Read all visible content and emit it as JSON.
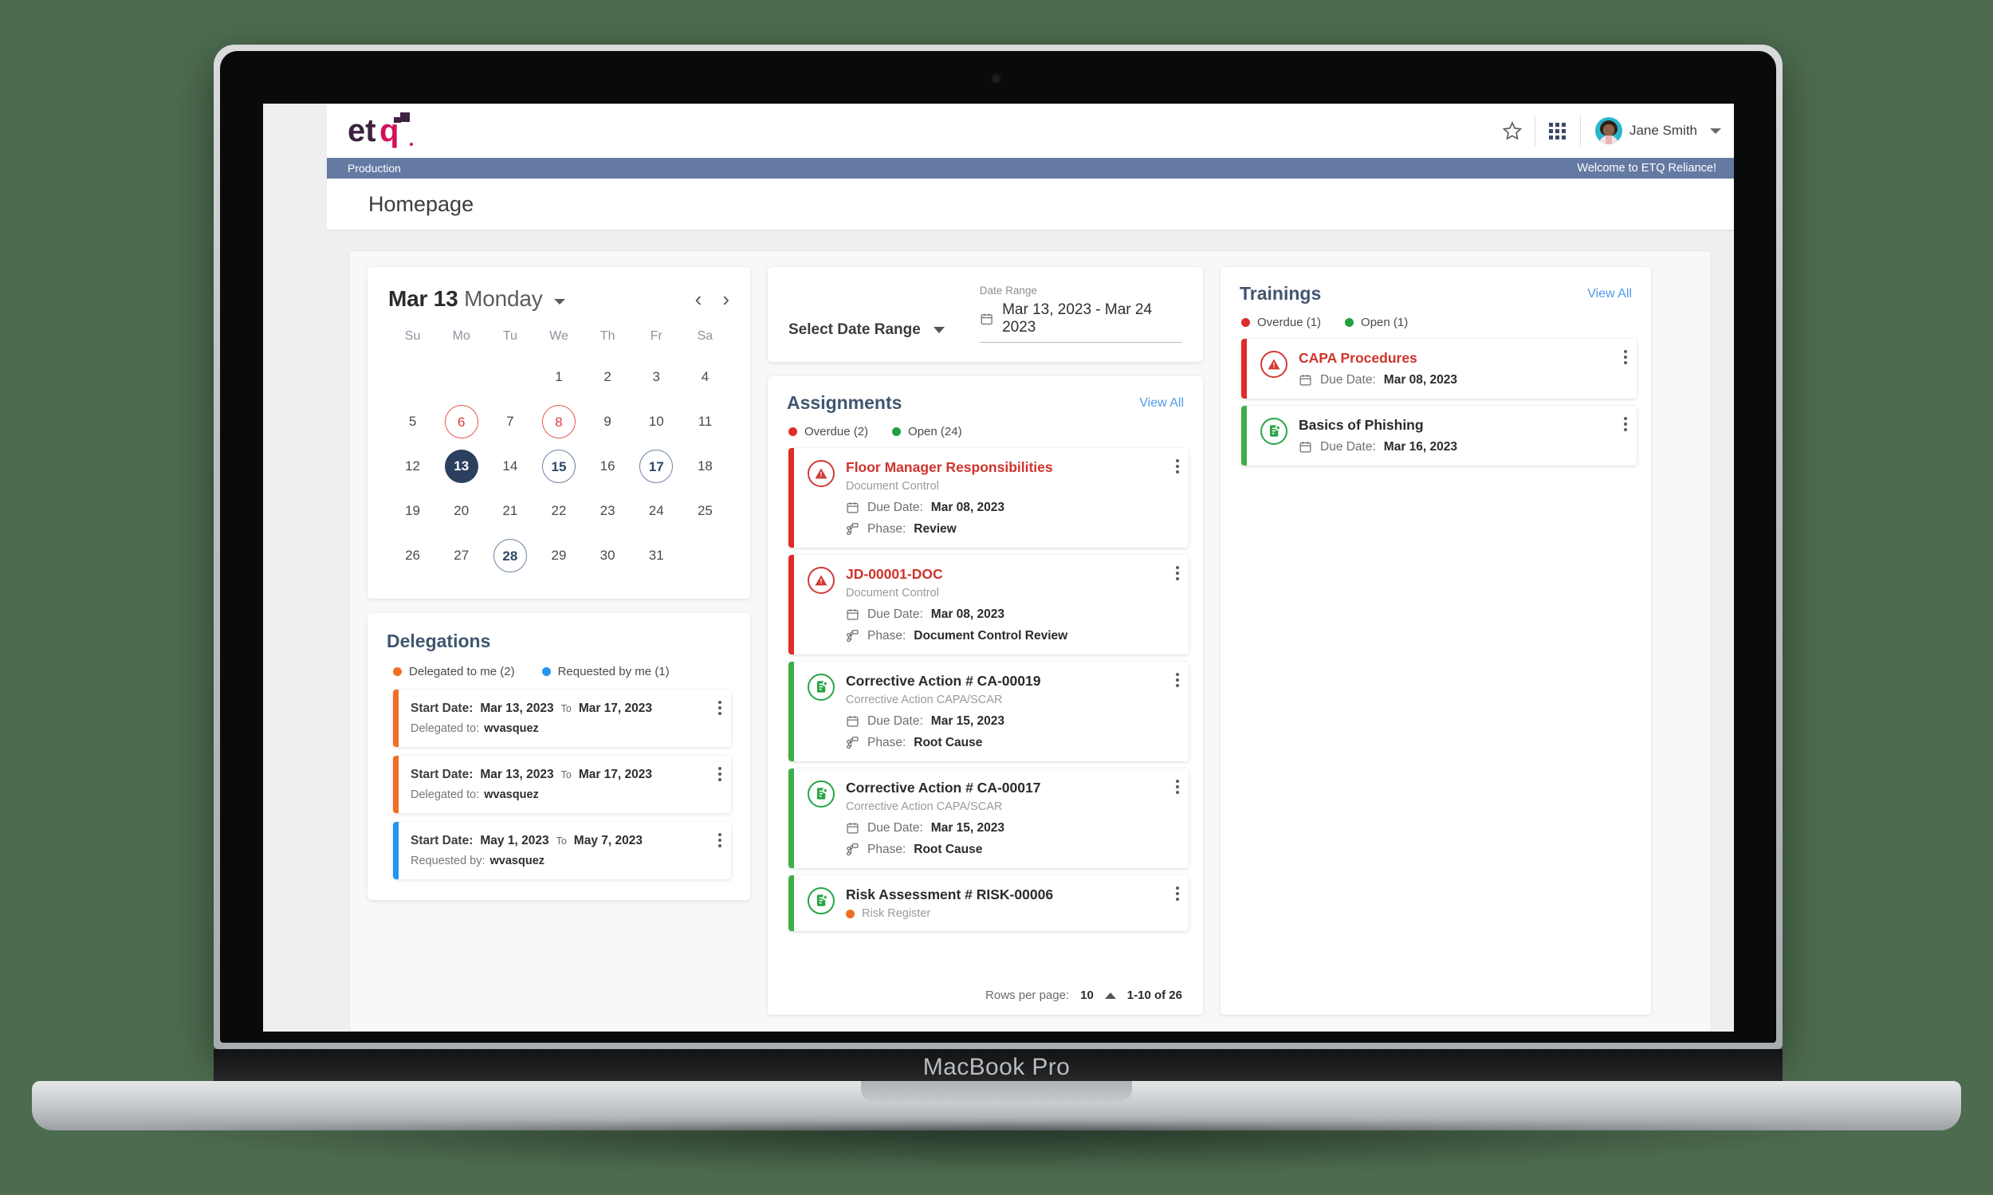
{
  "device": {
    "label": "MacBook Pro"
  },
  "header": {
    "logo_text": "etq",
    "star_icon": "star-icon",
    "grid_icon": "app-grid-icon",
    "user_name": "Jane Smith",
    "avatar_icon": "user-avatar"
  },
  "env_bar": {
    "environment": "Production",
    "welcome": "Welcome to ETQ Reliance!"
  },
  "page": {
    "title": "Homepage"
  },
  "calendar": {
    "month_day": "Mar 13",
    "weekday": "Monday",
    "prev_icon": "chevron-left-icon",
    "next_icon": "chevron-right-icon",
    "weekdays": [
      "Su",
      "Mo",
      "Tu",
      "We",
      "Th",
      "Fr",
      "Sa"
    ],
    "weeks": [
      [
        {
          "d": "",
          "s": ""
        },
        {
          "d": "",
          "s": ""
        },
        {
          "d": "",
          "s": ""
        },
        {
          "d": "1",
          "s": ""
        },
        {
          "d": "2",
          "s": ""
        },
        {
          "d": "3",
          "s": ""
        },
        {
          "d": "4",
          "s": ""
        }
      ],
      [
        {
          "d": "5",
          "s": ""
        },
        {
          "d": "6",
          "s": "overdue"
        },
        {
          "d": "7",
          "s": ""
        },
        {
          "d": "8",
          "s": "overdue"
        },
        {
          "d": "9",
          "s": ""
        },
        {
          "d": "10",
          "s": ""
        },
        {
          "d": "11",
          "s": ""
        }
      ],
      [
        {
          "d": "12",
          "s": ""
        },
        {
          "d": "13",
          "s": "today"
        },
        {
          "d": "14",
          "s": ""
        },
        {
          "d": "15",
          "s": "open"
        },
        {
          "d": "16",
          "s": ""
        },
        {
          "d": "17",
          "s": "open"
        },
        {
          "d": "18",
          "s": ""
        }
      ],
      [
        {
          "d": "19",
          "s": ""
        },
        {
          "d": "20",
          "s": ""
        },
        {
          "d": "21",
          "s": ""
        },
        {
          "d": "22",
          "s": ""
        },
        {
          "d": "23",
          "s": ""
        },
        {
          "d": "24",
          "s": ""
        },
        {
          "d": "25",
          "s": ""
        }
      ],
      [
        {
          "d": "26",
          "s": ""
        },
        {
          "d": "27",
          "s": ""
        },
        {
          "d": "28",
          "s": "open"
        },
        {
          "d": "29",
          "s": ""
        },
        {
          "d": "30",
          "s": ""
        },
        {
          "d": "31",
          "s": ""
        },
        {
          "d": "",
          "s": ""
        }
      ]
    ],
    "colors": {
      "today": "#2b3f5e",
      "overdue": "#e8574f",
      "open": "#6c83a3"
    }
  },
  "delegations": {
    "title": "Delegations",
    "legend": [
      {
        "label": "Delegated to me (2)",
        "color": "#f26f21"
      },
      {
        "label": "Requested by me (1)",
        "color": "#2196f3"
      }
    ],
    "items": [
      {
        "start_label": "Start Date:",
        "start": "Mar 13, 2023",
        "to_label": "To",
        "end": "Mar 17, 2023",
        "who_label": "Delegated to:",
        "who": "wvasquez",
        "color": "#f26f21"
      },
      {
        "start_label": "Start Date:",
        "start": "Mar 13, 2023",
        "to_label": "To",
        "end": "Mar 17, 2023",
        "who_label": "Delegated to:",
        "who": "wvasquez",
        "color": "#f26f21"
      },
      {
        "start_label": "Start Date:",
        "start": "May 1, 2023",
        "to_label": "To",
        "end": "May 7, 2023",
        "who_label": "Requested by:",
        "who": "wvasquez",
        "color": "#2196f3"
      }
    ]
  },
  "date_range": {
    "select_label": "Select Date Range",
    "field_label": "Date Range",
    "value": "Mar 13, 2023 - Mar 24 2023",
    "calendar_icon": "calendar-icon"
  },
  "assignments": {
    "title": "Assignments",
    "view_all": "View All",
    "legend": [
      {
        "label": "Overdue (2)",
        "color": "#e02b2b"
      },
      {
        "label": "Open (24)",
        "color": "#22a03f"
      }
    ],
    "items": [
      {
        "title": "Floor Manager Responsibilities",
        "subtitle": "Document Control",
        "due_label": "Due Date:",
        "due": "Mar 08, 2023",
        "phase_label": "Phase:",
        "phase": "Review",
        "status": "overdue",
        "color": "#e02b2b",
        "icon": "warning-triangle-icon"
      },
      {
        "title": "JD-00001-DOC",
        "subtitle": "Document Control",
        "due_label": "Due Date:",
        "due": "Mar 08, 2023",
        "phase_label": "Phase:",
        "phase": "Document Control Review",
        "status": "overdue",
        "color": "#e02b2b",
        "icon": "warning-triangle-icon"
      },
      {
        "title": "Corrective Action # CA-00019",
        "subtitle": "Corrective Action CAPA/SCAR",
        "due_label": "Due Date:",
        "due": "Mar 15, 2023",
        "phase_label": "Phase:",
        "phase": "Root Cause",
        "status": "open",
        "color": "#3fae4a",
        "icon": "document-plus-icon"
      },
      {
        "title": "Corrective Action # CA-00017",
        "subtitle": "Corrective Action CAPA/SCAR",
        "due_label": "Due Date:",
        "due": "Mar 15, 2023",
        "phase_label": "Phase:",
        "phase": "Root Cause",
        "status": "open",
        "color": "#3fae4a",
        "icon": "document-plus-icon"
      },
      {
        "title": "Risk Assessment # RISK-00006",
        "subtitle": "Risk Register",
        "subtitle_dot": "#f26f21",
        "status": "open",
        "color": "#3fae4a",
        "icon": "document-plus-icon"
      }
    ],
    "footer": {
      "rows_label": "Rows per page:",
      "rows_value": "10",
      "range": "1-10 of 26",
      "sort_icon": "caret-up-icon"
    }
  },
  "trainings": {
    "title": "Trainings",
    "view_all": "View All",
    "legend": [
      {
        "label": "Overdue (1)",
        "color": "#e02b2b"
      },
      {
        "label": "Open (1)",
        "color": "#22a03f"
      }
    ],
    "items": [
      {
        "title": "CAPA Procedures",
        "due_label": "Due Date:",
        "due": "Mar 08, 2023",
        "status": "overdue",
        "color": "#e02b2b",
        "icon": "warning-triangle-icon"
      },
      {
        "title": "Basics of Phishing",
        "due_label": "Due Date:",
        "due": "Mar 16, 2023",
        "status": "open",
        "color": "#3fae4a",
        "icon": "document-plus-icon"
      }
    ]
  }
}
